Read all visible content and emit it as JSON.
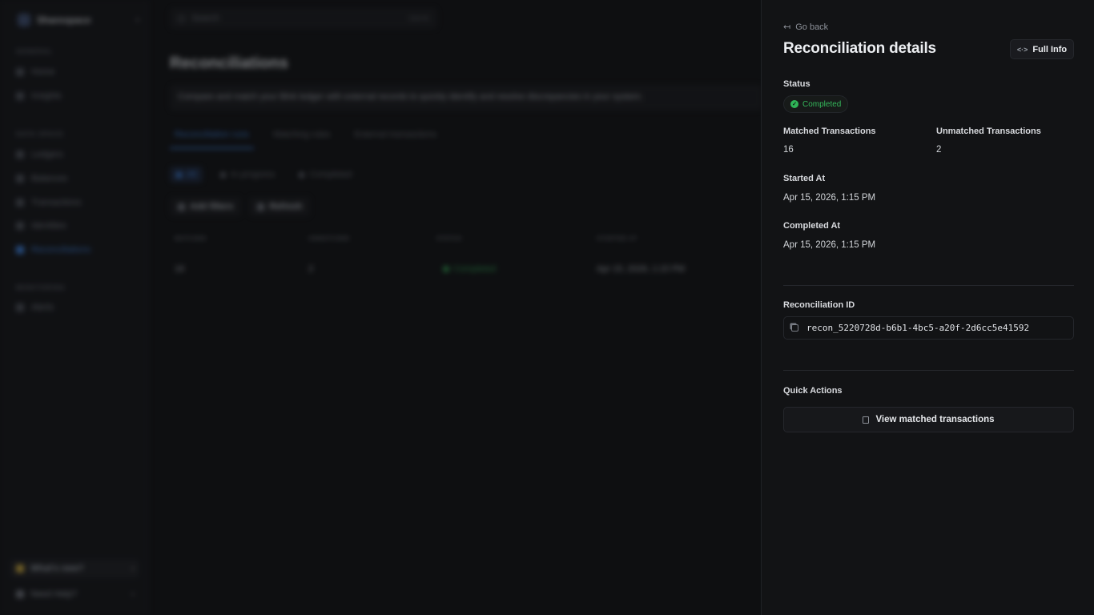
{
  "background": {
    "workspace_name": "Sharespace",
    "search": {
      "placeholder": "Search",
      "shortcut": "Ctrl+K"
    },
    "sidebar": {
      "sections": [
        {
          "title": "GENERAL",
          "items": [
            "Home",
            "Insights"
          ]
        },
        {
          "title": "DATA SPACE",
          "items": [
            "Ledgers",
            "Balances",
            "Transactions",
            "Identities",
            "Reconciliations"
          ]
        },
        {
          "title": "MONITORING",
          "items": [
            "Alerts"
          ]
        }
      ],
      "active_item": "Reconciliations",
      "whats_new": "What's new?",
      "need_help": "Need Help?"
    },
    "page_title": "Reconciliations",
    "description": "Compare and match your Blnk ledger with external records to quickly identify and resolve discrepancies in your system.",
    "tabs": [
      "Reconciliation runs",
      "Matching rules",
      "External transactions"
    ],
    "filter_chips": [
      "All",
      "In progress",
      "Completed"
    ],
    "buttons": {
      "add_filters": "Add filters",
      "refresh": "Refresh"
    },
    "table": {
      "headers": [
        "MATCHED",
        "UNMATCHED",
        "STATUS",
        "STARTED AT"
      ],
      "row": {
        "matched": "16",
        "unmatched": "2",
        "status": "Completed",
        "started_at": "Apr 15, 2026, 1:15 PM"
      }
    }
  },
  "panel": {
    "go_back": "Go back",
    "title": "Reconciliation details",
    "full_info": "Full Info",
    "status_label": "Status",
    "status_value": "Completed",
    "matched_label": "Matched Transactions",
    "matched_value": "16",
    "unmatched_label": "Unmatched Transactions",
    "unmatched_value": "2",
    "started_label": "Started At",
    "started_value": "Apr 15, 2026, 1:15 PM",
    "completed_label": "Completed At",
    "completed_value": "Apr 15, 2026, 1:15 PM",
    "id_label": "Reconciliation ID",
    "id_value": "recon_5220728d-b6b1-4bc5-a20f-2d6cc5e41592",
    "quick_actions_label": "Quick Actions",
    "view_matched": "View matched transactions"
  },
  "colors": {
    "accent": "#3a7bd5",
    "success": "#2fb457",
    "panel_bg": "#121315"
  }
}
